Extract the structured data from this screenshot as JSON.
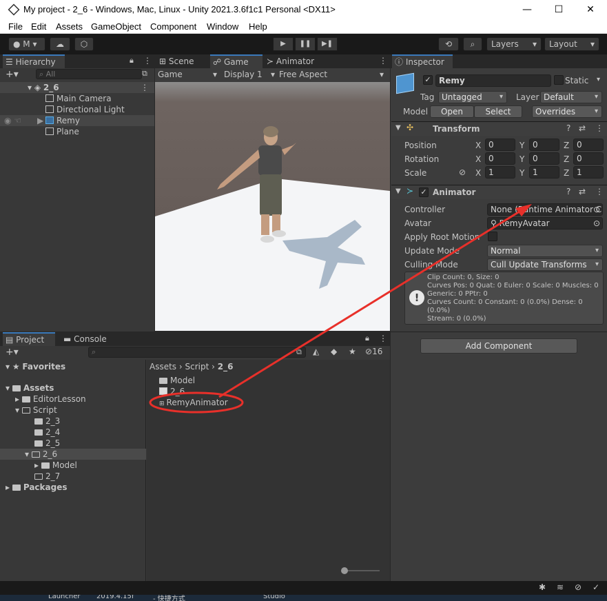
{
  "window": {
    "title": "My project - 2_6 - Windows, Mac, Linux - Unity 2021.3.6f1c1 Personal <DX11>",
    "minimize": "—",
    "maximize": "☐",
    "close": "✕"
  },
  "menu": [
    "File",
    "Edit",
    "Assets",
    "GameObject",
    "Component",
    "Window",
    "Help"
  ],
  "toolbar": {
    "account": "M",
    "layers": "Layers",
    "layout": "Layout"
  },
  "hierarchy": {
    "tab": "Hierarchy",
    "search_placeholder": "All",
    "scene": "2_6",
    "items": [
      "Main Camera",
      "Directional Light",
      "Remy",
      "Plane"
    ]
  },
  "scene_tabs": [
    "Scene",
    "Game",
    "Animator"
  ],
  "game_bar": {
    "mode": "Game",
    "display": "Display 1",
    "aspect": "Free Aspect"
  },
  "inspector": {
    "tab": "Inspector",
    "object_name": "Remy",
    "static_label": "Static",
    "tag_label": "Tag",
    "tag_value": "Untagged",
    "layer_label": "Layer",
    "layer_value": "Default",
    "model_label": "Model",
    "open": "Open",
    "select": "Select",
    "overrides": "Overrides",
    "transform": {
      "title": "Transform",
      "position_label": "Position",
      "rotation_label": "Rotation",
      "scale_label": "Scale",
      "position": [
        "0",
        "0",
        "0"
      ],
      "rotation": [
        "0",
        "0",
        "0"
      ],
      "scale": [
        "1",
        "1",
        "1"
      ]
    },
    "animator": {
      "title": "Animator",
      "controller_label": "Controller",
      "controller_value": "None (Runtime Animator C",
      "avatar_label": "Avatar",
      "avatar_value": "RemyAvatar",
      "root_motion_label": "Apply Root Motion",
      "update_mode_label": "Update Mode",
      "update_mode_value": "Normal",
      "culling_label": "Culling Mode",
      "culling_value": "Cull Update Transforms",
      "info": [
        "Clip Count: 0, Size: 0",
        "Curves Pos: 0 Quat: 0 Euler: 0 Scale: 0 Muscles: 0",
        "Generic: 0 PPtr: 0",
        "Curves Count: 0 Constant: 0 (0.0%) Dense: 0 (0.0%)",
        "Stream: 0 (0.0%)"
      ]
    },
    "add_component": "Add Component"
  },
  "project": {
    "tabs": [
      "Project",
      "Console"
    ],
    "hidden_count": "16",
    "breadcrumb": [
      "Assets",
      "Script",
      "2_6"
    ],
    "tree": {
      "favorites": "Favorites",
      "assets": "Assets",
      "editor_lesson": "EditorLesson",
      "script": "Script",
      "s23": "2_3",
      "s24": "2_4",
      "s25": "2_5",
      "s26": "2_6",
      "model": "Model",
      "s27": "2_7",
      "packages": "Packages"
    },
    "files": [
      "Model",
      "2_6",
      "RemyAnimator"
    ]
  },
  "taskbar": [
    "Launcher",
    "2019.4.15f",
    "- 快捷方式",
    "Studio"
  ],
  "colors": {
    "annotation": "#e8302a",
    "accent": "#3a79bb",
    "selection": "#2c5d87"
  }
}
